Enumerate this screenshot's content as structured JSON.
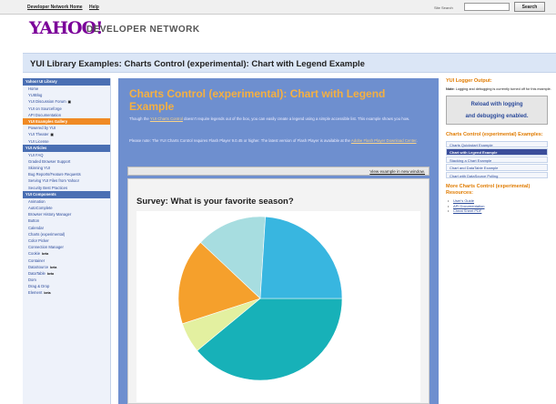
{
  "topbar": {
    "links": [
      "Developer Network Home",
      "Help"
    ],
    "search_label": "Site Search",
    "search_value": "",
    "search_button": "Search"
  },
  "brand": {
    "logo": "YAHOO!",
    "network": "DEVELOPER NETWORK"
  },
  "page_title": "YUI Library Examples: Charts Control (experimental): Chart with Legend Example",
  "sidebar": {
    "sections": [
      {
        "header": "Yahoo! UI Library",
        "items": [
          {
            "label": "Home"
          },
          {
            "label": "YUIBlog"
          },
          {
            "label": "YUI Discussion Forum",
            "badge": "▣"
          },
          {
            "label": "YUI on Sourceforge"
          },
          {
            "label": "API Documentation"
          },
          {
            "label": "YUI Examples Gallery",
            "selected": true
          },
          {
            "label": "Powered by YUI"
          },
          {
            "label": "YUI Theater",
            "badge": "▣"
          },
          {
            "label": "YUI License"
          }
        ]
      },
      {
        "header": "YUI Articles",
        "items": [
          {
            "label": "YUI FAQ"
          },
          {
            "label": "Graded Browser Support"
          },
          {
            "label": "Skinning YUI"
          },
          {
            "label": "Bug Reports/Feature Requests"
          },
          {
            "label": "Serving YUI Files from Yahoo!"
          },
          {
            "label": "Security Best Practices"
          }
        ]
      },
      {
        "header": "YUI Components",
        "items": [
          {
            "label": "Animation"
          },
          {
            "label": "AutoComplete"
          },
          {
            "label": "Browser History Manager"
          },
          {
            "label": "Button"
          },
          {
            "label": "Calendar"
          },
          {
            "label": "Charts (experimental)"
          },
          {
            "label": "Color Picker"
          },
          {
            "label": "Connection Manager"
          },
          {
            "label": "Cookie",
            "badge": "beta"
          },
          {
            "label": "Container"
          },
          {
            "label": "DataSource",
            "badge": "beta"
          },
          {
            "label": "DataTable",
            "badge": "beta"
          },
          {
            "label": "Dom"
          },
          {
            "label": "Drag & Drop"
          },
          {
            "label": "Element",
            "badge": "beta"
          }
        ]
      }
    ]
  },
  "main": {
    "heading": "Charts Control (experimental): Chart with Legend Example",
    "intro_pre": "Though the ",
    "intro_link": "YUI Charts Control",
    "intro_post": " doesn't require legends out of the box, you can easily create a legend using a simple accessible list. This example shows you how.",
    "req_pre": "Please note: The YUI Charts Control requires Flash Player 9.0.45 or higher. The latest version of Flash Player is available at the ",
    "req_link": "Adobe Flash Player Download Center",
    "req_post": ".",
    "view_link": "View example in new window.",
    "chart_title": "Survey: What is your favorite season?"
  },
  "chart_data": {
    "type": "pie",
    "title": "Survey: What is your favorite season?",
    "slices": [
      {
        "value": 39,
        "color": "#17b1b8"
      },
      {
        "value": 6,
        "color": "#e3f0a0"
      },
      {
        "value": 17,
        "color": "#f5a02c"
      },
      {
        "value": 14,
        "color": "#a7dde0"
      },
      {
        "value": 24,
        "color": "#38b6e0"
      }
    ],
    "start_angle_deg": 0
  },
  "right": {
    "logger_title": "YUI Logger Output:",
    "logger_note_bold": "Note:",
    "logger_note": " Logging and debugging is currently turned off for this example.",
    "reload_button_line1": "Reload with logging",
    "reload_button_line2": "and debugging enabled.",
    "examples_title": "Charts Control (experimental) Examples:",
    "examples": [
      {
        "label": "Charts Quickstart Example"
      },
      {
        "label": "Chart with Legend Example",
        "selected": true
      },
      {
        "label": "Stacking a Chart Example"
      },
      {
        "label": "Chart and DataTable Example"
      },
      {
        "label": "Chart with DataSource Polling"
      }
    ],
    "resources_title": "More Charts Control (experimental) Resources:",
    "resources": [
      "User's Guide",
      "API Documentation",
      "Cheat Sheet PDF"
    ]
  }
}
